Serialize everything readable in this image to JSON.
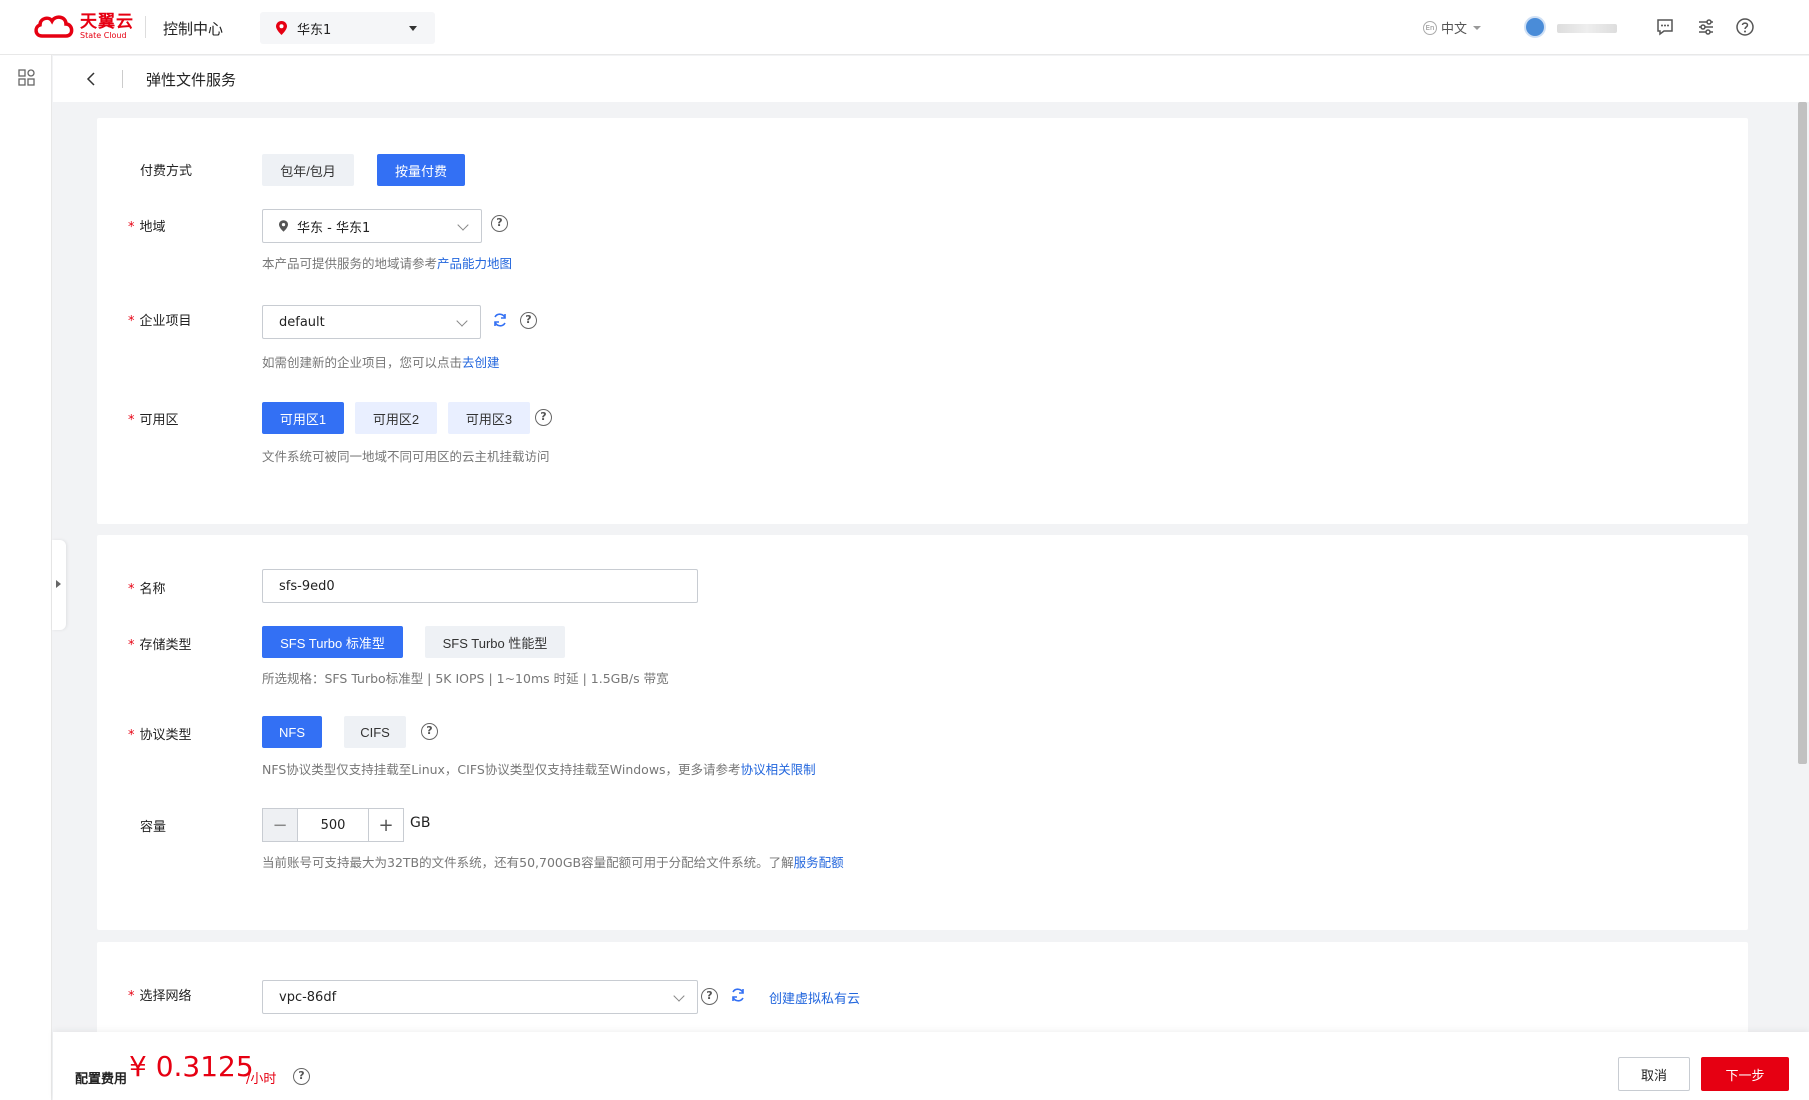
{
  "header": {
    "logo_cn": "天翼云",
    "logo_en": "State Cloud",
    "console_title": "控制中心",
    "region": "华东1",
    "language": "中文",
    "language_icon_text": "En"
  },
  "breadcrumb": {
    "title": "弹性文件服务"
  },
  "billing": {
    "label": "付费方式",
    "options": [
      "包年/包月",
      "按量付费"
    ],
    "selected": "按量付费"
  },
  "region": {
    "label": "地域",
    "value": "华东 - 华东1",
    "hint_prefix": "本产品可提供服务的地域请参考",
    "hint_link": "产品能力地图"
  },
  "project": {
    "label": "企业项目",
    "value": "default",
    "hint_prefix": "如需创建新的企业项目，您可以点击",
    "hint_link": "去创建"
  },
  "zone": {
    "label": "可用区",
    "options": [
      "可用区1",
      "可用区2",
      "可用区3"
    ],
    "selected": "可用区1",
    "hint": "文件系统可被同一地域不同可用区的云主机挂载访问"
  },
  "name": {
    "label": "名称",
    "value": "sfs-9ed0"
  },
  "storage_type": {
    "label": "存储类型",
    "options": [
      "SFS Turbo 标准型",
      "SFS Turbo 性能型"
    ],
    "selected": "SFS Turbo 标准型",
    "hint": "所选规格：SFS Turbo标准型 | 5K IOPS | 1~10ms 时延 | 1.5GB/s 带宽"
  },
  "protocol": {
    "label": "协议类型",
    "options": [
      "NFS",
      "CIFS"
    ],
    "selected": "NFS",
    "hint_prefix": "NFS协议类型仅支持挂载至Linux，CIFS协议类型仅支持挂载至Windows，更多请参考",
    "hint_link": "协议相关限制"
  },
  "capacity": {
    "label": "容量",
    "value": "500",
    "unit": "GB",
    "minus": "−",
    "plus": "+",
    "hint_prefix": "当前账号可支持最大为32TB的文件系统，还有50,700GB容量配额可用于分配给文件系统。了解",
    "hint_link": "服务配额"
  },
  "network": {
    "label": "选择网络",
    "value": "vpc-86df",
    "create_link": "创建虚拟私有云"
  },
  "footer": {
    "fee_label": "配置费用",
    "fee_amount": "¥ 0.3125",
    "fee_unit": "/小时",
    "cancel": "取消",
    "next": "下一步"
  },
  "colors": {
    "primary": "#3370f4",
    "brand_red": "#e60012",
    "link": "#2266dd"
  },
  "help_glyph": "?",
  "required_mark": "*"
}
